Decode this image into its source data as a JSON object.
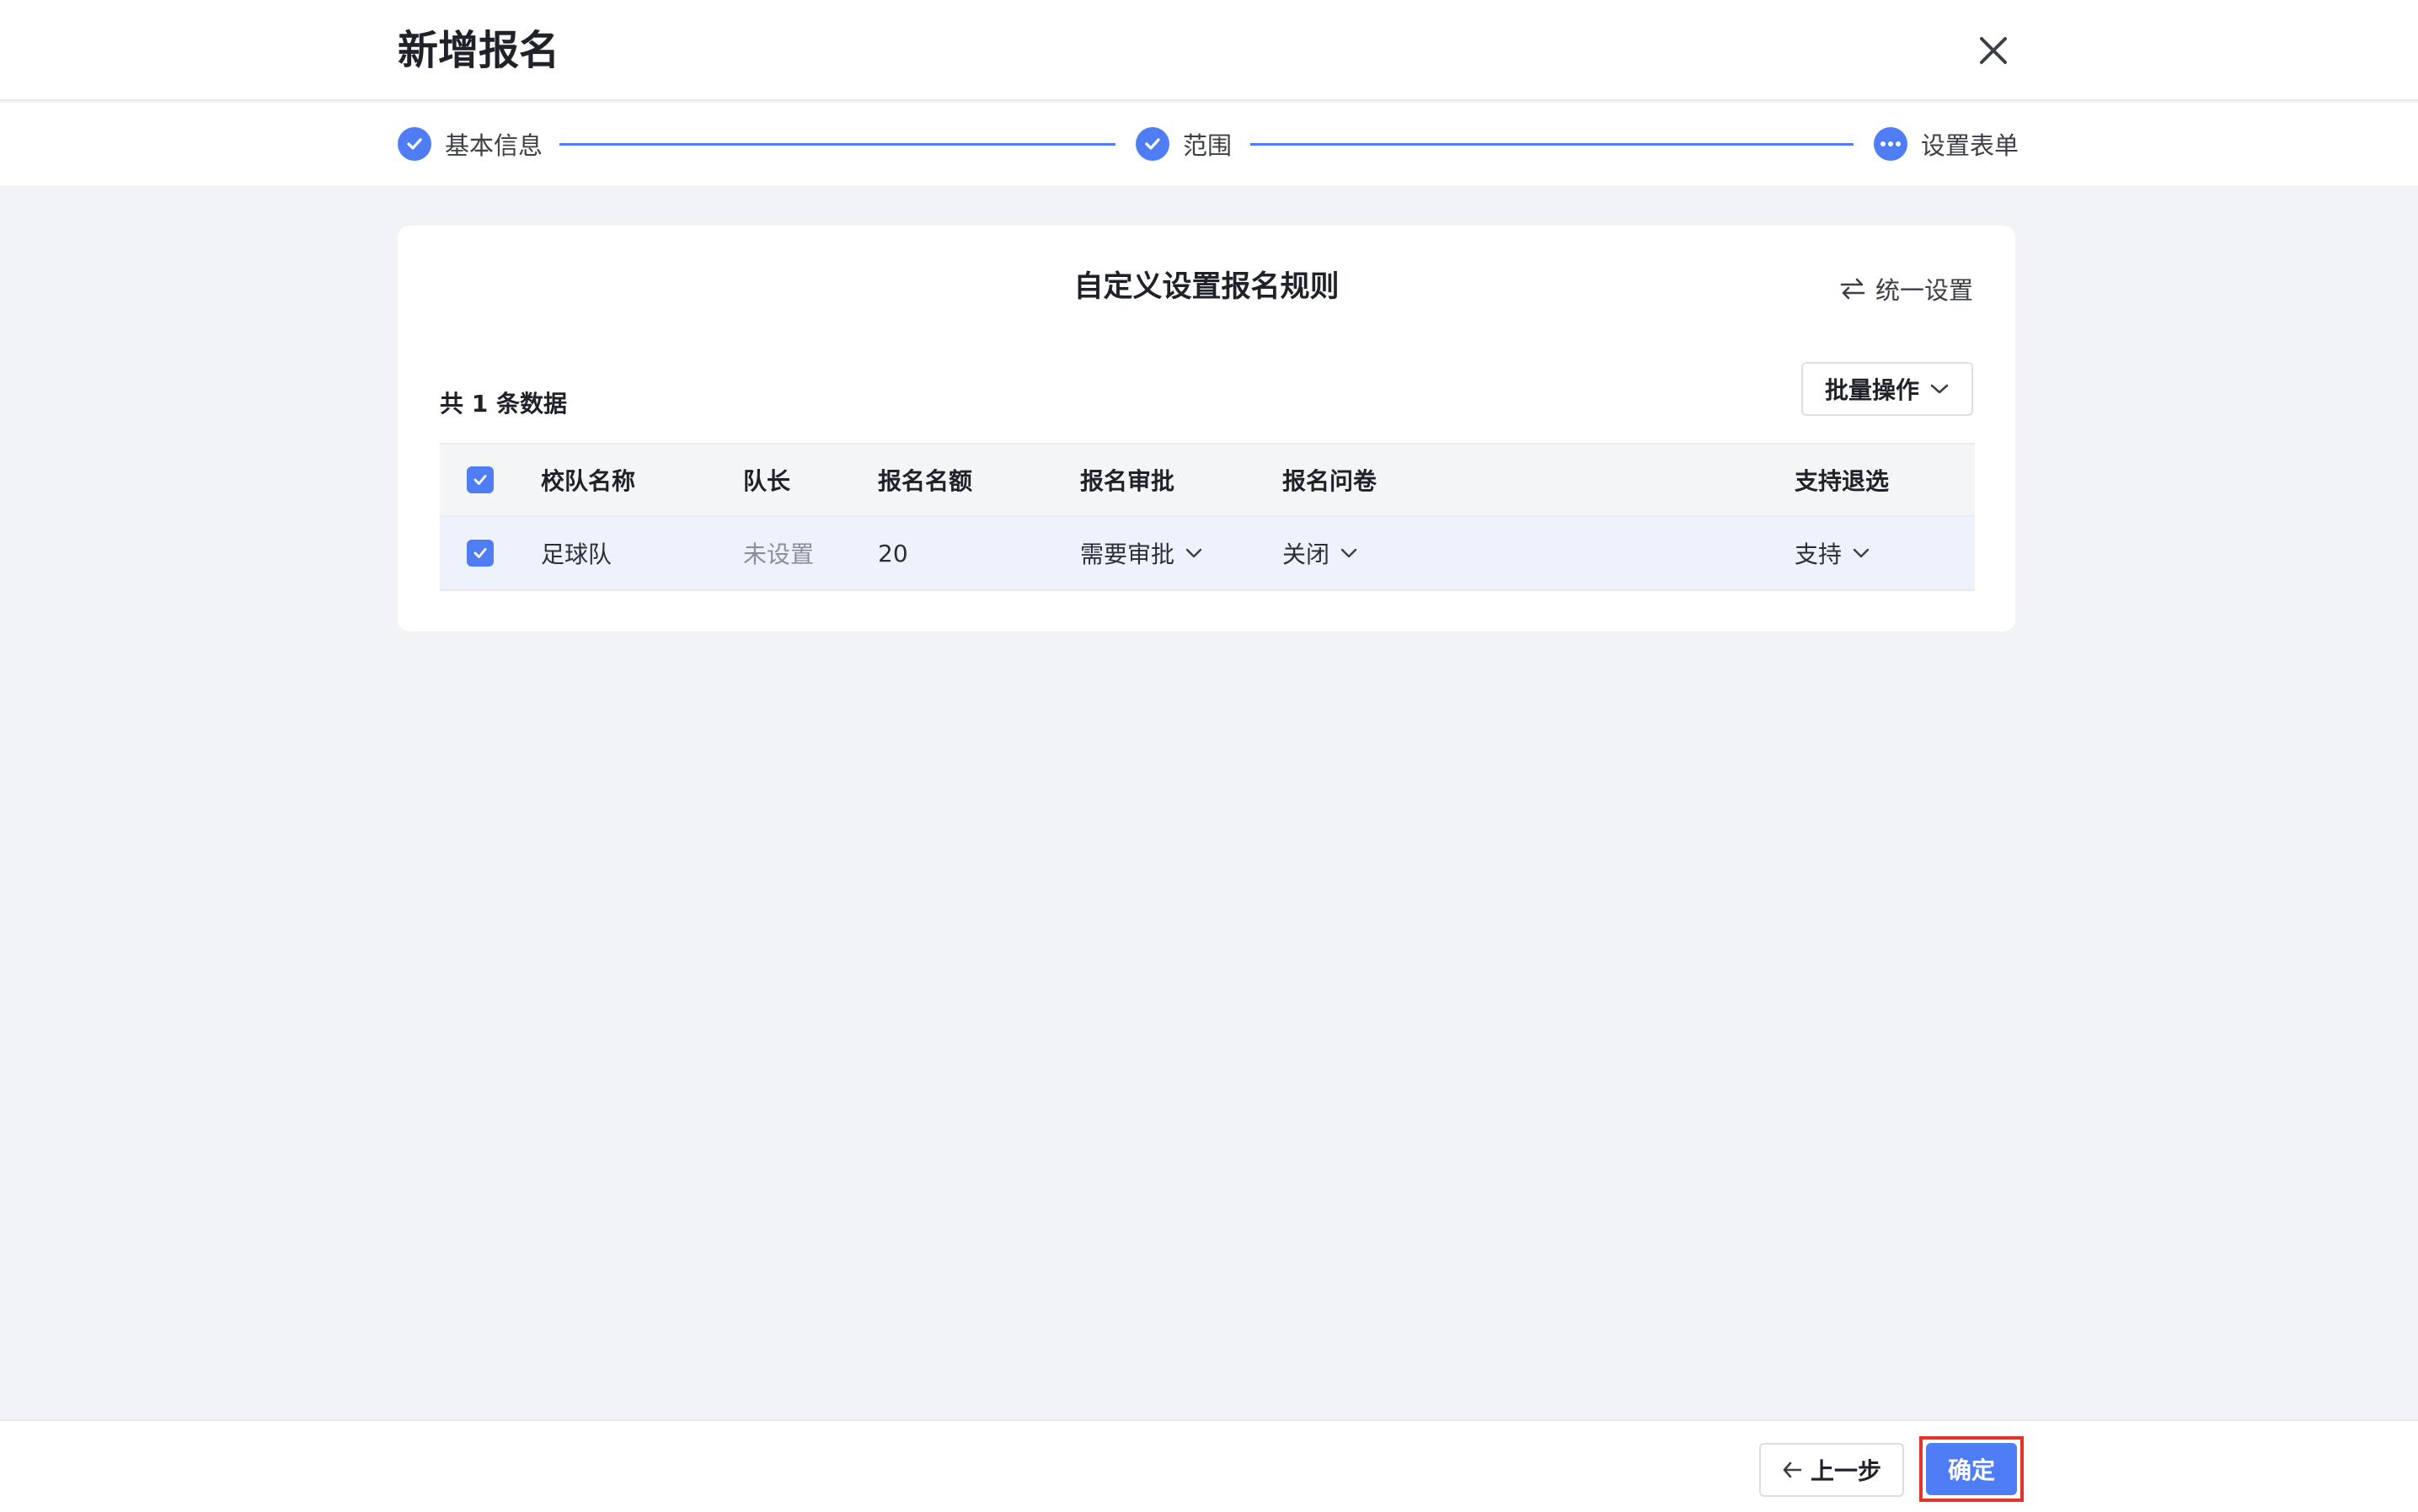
{
  "header": {
    "title": "新增报名",
    "close_icon": "close-icon"
  },
  "steps": [
    {
      "label": "基本信息",
      "status": "done",
      "icon": "check-circle-icon"
    },
    {
      "label": "范围",
      "status": "done",
      "icon": "check-circle-icon"
    },
    {
      "label": "设置表单",
      "status": "current",
      "icon": "more-dots-icon"
    }
  ],
  "card": {
    "title": "自定义设置报名规则",
    "unify_label": "统一设置",
    "unify_icon": "swap-arrows-icon",
    "count_text": "共 1 条数据",
    "batch_label": "批量操作"
  },
  "table": {
    "columns": [
      "校队名称",
      "队长",
      "报名名额",
      "报名审批",
      "报名问卷",
      "支持退选"
    ],
    "rows": [
      {
        "checked": true,
        "name": "足球队",
        "captain": "未设置",
        "quota": "20",
        "approval": "需要审批",
        "questionnaire": "关闭",
        "withdraw": "支持"
      }
    ],
    "header_checked": true
  },
  "footer": {
    "prev_label": "上一步",
    "ok_label": "确定"
  },
  "colors": {
    "accent": "#4f7df5",
    "highlight_border": "#e5332a",
    "row_selected_bg": "#edf2fd"
  }
}
